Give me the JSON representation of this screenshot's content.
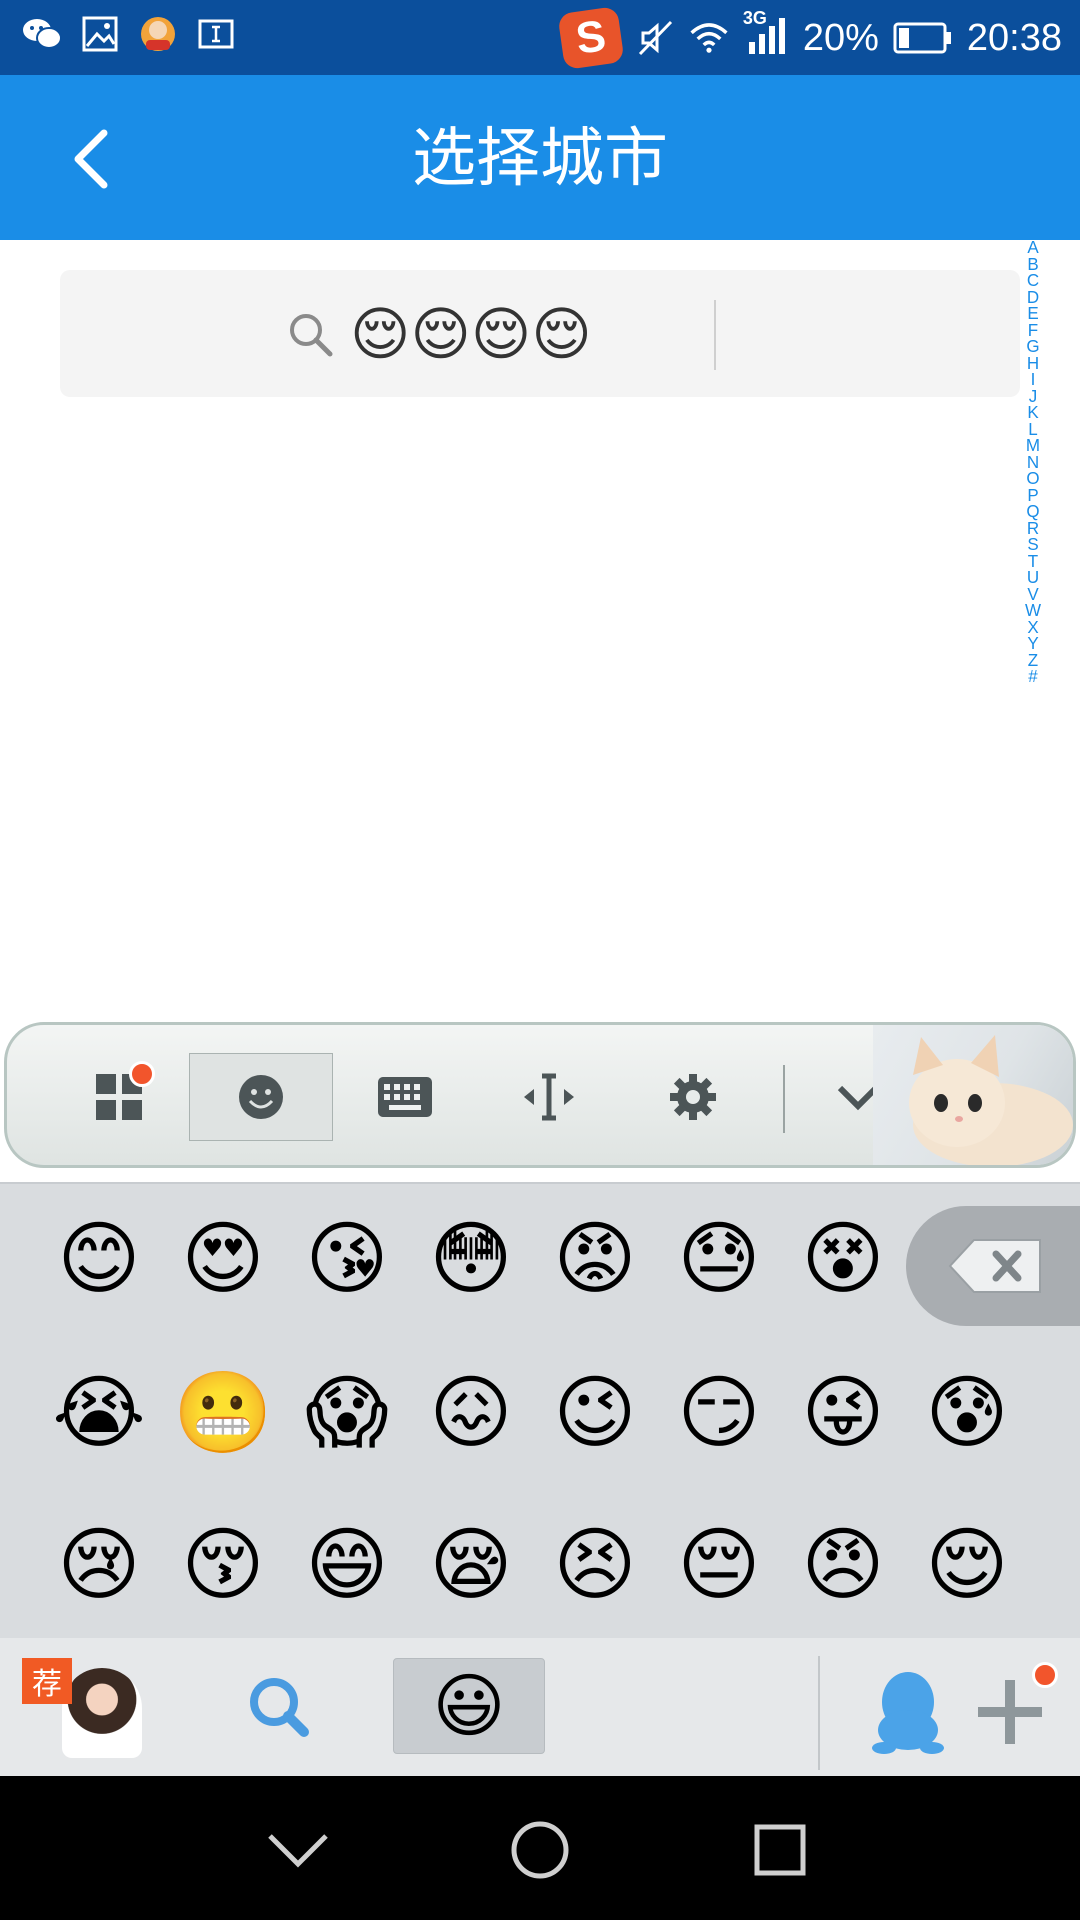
{
  "status_bar": {
    "battery_percent": "20%",
    "time": "20:38",
    "network": "3G",
    "left_icons": [
      "wechat-icon",
      "gallery-icon",
      "game-icon",
      "input-icon"
    ],
    "right_icons": [
      "sogou-icon",
      "mute-icon",
      "wifi-icon",
      "signal-icon",
      "battery-icon"
    ]
  },
  "header": {
    "title": "选择城市",
    "back_icon": "chevron-left-icon"
  },
  "search": {
    "icon": "search-icon",
    "value": "😌😌😌😌"
  },
  "alphabet_index": [
    "A",
    "B",
    "C",
    "D",
    "E",
    "F",
    "G",
    "H",
    "I",
    "J",
    "K",
    "L",
    "M",
    "N",
    "O",
    "P",
    "Q",
    "R",
    "S",
    "T",
    "U",
    "V",
    "W",
    "X",
    "Y",
    "Z",
    "#"
  ],
  "ime_toolbar": {
    "items": [
      "apps-icon",
      "emoji-icon",
      "keyboard-icon",
      "cursor-move-icon",
      "settings-icon",
      "collapse-icon"
    ],
    "active": "emoji-icon",
    "notification_color": "#f2552c"
  },
  "emoji_grid": {
    "rows": [
      [
        "😊",
        "😍",
        "😘",
        "😳",
        "😡",
        "😓",
        "😵"
      ],
      [
        "😭",
        "😬",
        "😱",
        "😖",
        "😉",
        "😏",
        "😜",
        "😰"
      ],
      [
        "😢",
        "😚",
        "😄",
        "😪",
        "😣",
        "😔",
        "😠",
        "😌"
      ]
    ]
  },
  "ime_bottom": {
    "recommend_badge": "荐",
    "active_emoji": "😃",
    "icons": [
      "search-icon",
      "emoji-icon",
      "qq-icon",
      "add-icon"
    ]
  },
  "colors": {
    "title_bar": "#1a8de7",
    "status_bar": "#0b4f9c",
    "index_text": "#1a8de7"
  }
}
